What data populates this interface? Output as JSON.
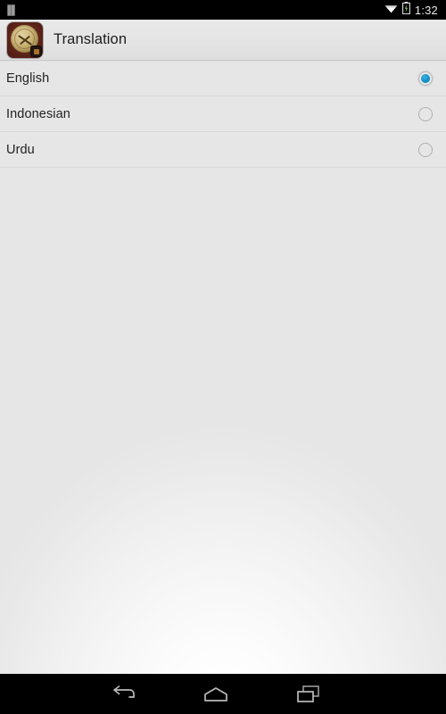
{
  "status_bar": {
    "notification_icon": "sim-card-icon",
    "wifi_icon": "wifi-icon",
    "battery_icon": "battery-charging-icon",
    "time": "1:32",
    "background_color": "#000000",
    "text_color": "#e8e8e8"
  },
  "action_bar": {
    "app_icon": "app-logo-icon",
    "title": "Translation",
    "background_color": "#e6e6e6",
    "title_color": "#1d1d1d"
  },
  "main": {
    "list_title": "Translation",
    "background_color": "#e6e6e6",
    "accent_color": "#0f90c6",
    "selected_value": "English",
    "options": [
      {
        "label": "English",
        "selected": true,
        "radio_icon": "radio-checked-icon"
      },
      {
        "label": "Indonesian",
        "selected": false,
        "radio_icon": "radio-unchecked-icon"
      },
      {
        "label": "Urdu",
        "selected": false,
        "radio_icon": "radio-unchecked-icon"
      }
    ]
  },
  "nav_bar": {
    "background_color": "#000000",
    "buttons": [
      {
        "name": "back",
        "icon": "back-arrow-icon"
      },
      {
        "name": "home",
        "icon": "home-icon"
      },
      {
        "name": "recents",
        "icon": "recent-apps-icon"
      }
    ]
  }
}
